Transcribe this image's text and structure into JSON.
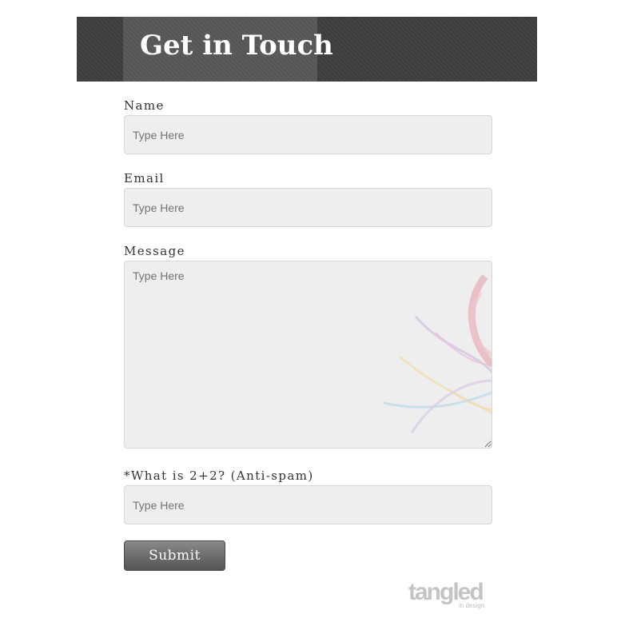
{
  "header": {
    "title": "Get in Touch"
  },
  "form": {
    "name_label": "Name",
    "name_placeholder": "Type Here",
    "email_label": "Email",
    "email_placeholder": "Type Here",
    "message_label": "Message",
    "message_placeholder": "Type Here",
    "antispam_label": "*What is 2+2? (Anti-spam)",
    "antispam_placeholder": "Type Here",
    "submit_label": "Submit"
  },
  "footer": {
    "logo_word": "tangled",
    "logo_tagline": "in design"
  },
  "colors": {
    "header_band": "#3f3f3f",
    "title_panel": "#585858",
    "field_background": "#eeeeee",
    "button": "#6b6b6b"
  }
}
